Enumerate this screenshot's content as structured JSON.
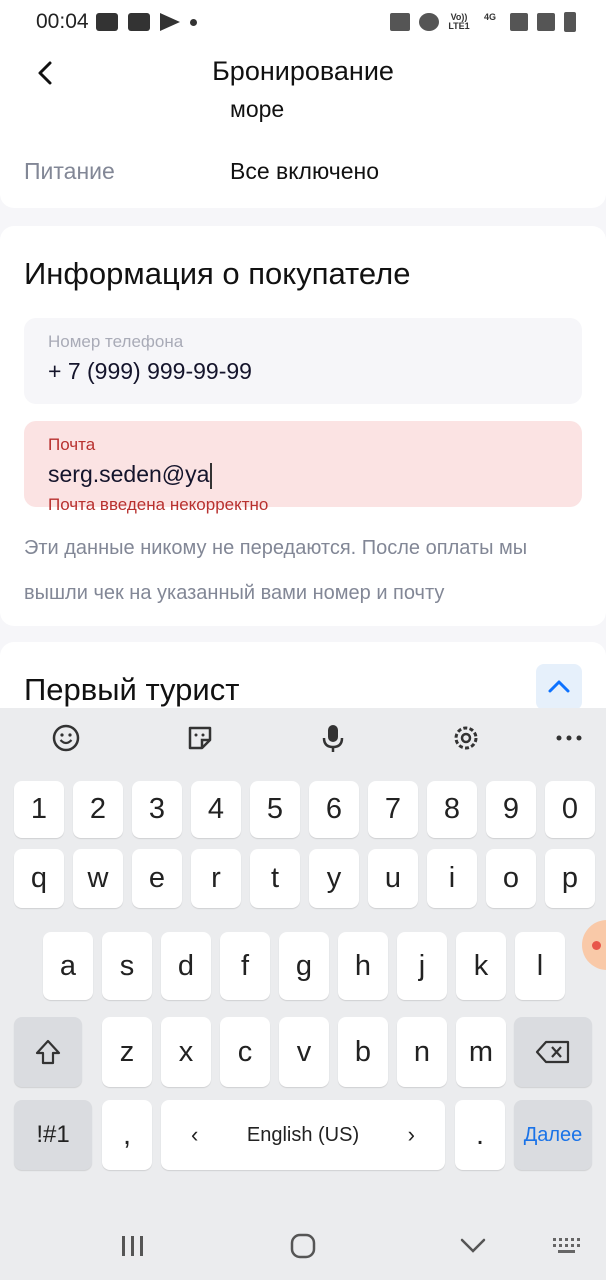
{
  "status_bar": {
    "time": "00:04",
    "net1": "Vo)) LTE1",
    "net2": "4G"
  },
  "header": {
    "title": "Бронирование"
  },
  "hotel_details": {
    "partial_value": "море",
    "meal_label": "Питание",
    "meal_value": "Все включено"
  },
  "buyer_info": {
    "title": "Информация о покупателе",
    "phone": {
      "label": "Номер телефона",
      "value": "+ 7 (999) 999-99-99"
    },
    "email": {
      "label": "Почта",
      "value": "serg.seden@ya",
      "error": "Почта введена некорректно"
    },
    "note": "Эти данные никому не передаются. После оплаты мы вышли чек на указанный вами номер и почту"
  },
  "tourist": {
    "title": "Первый турист"
  },
  "keyboard": {
    "row_numbers": [
      "1",
      "2",
      "3",
      "4",
      "5",
      "6",
      "7",
      "8",
      "9",
      "0"
    ],
    "row1": [
      "q",
      "w",
      "e",
      "r",
      "t",
      "y",
      "u",
      "i",
      "o",
      "p"
    ],
    "row2": [
      "a",
      "s",
      "d",
      "f",
      "g",
      "h",
      "j",
      "k",
      "l"
    ],
    "row3": [
      "z",
      "x",
      "c",
      "v",
      "b",
      "n",
      "m"
    ],
    "symbols": "!#1",
    "comma": ",",
    "language": "English (US)",
    "period": ".",
    "action": "Далее",
    "action_color": "#1A73E8"
  },
  "colors": {
    "accent": "#0D72FF",
    "error": "#B8312F",
    "error_bg": "#FBE3E3"
  }
}
